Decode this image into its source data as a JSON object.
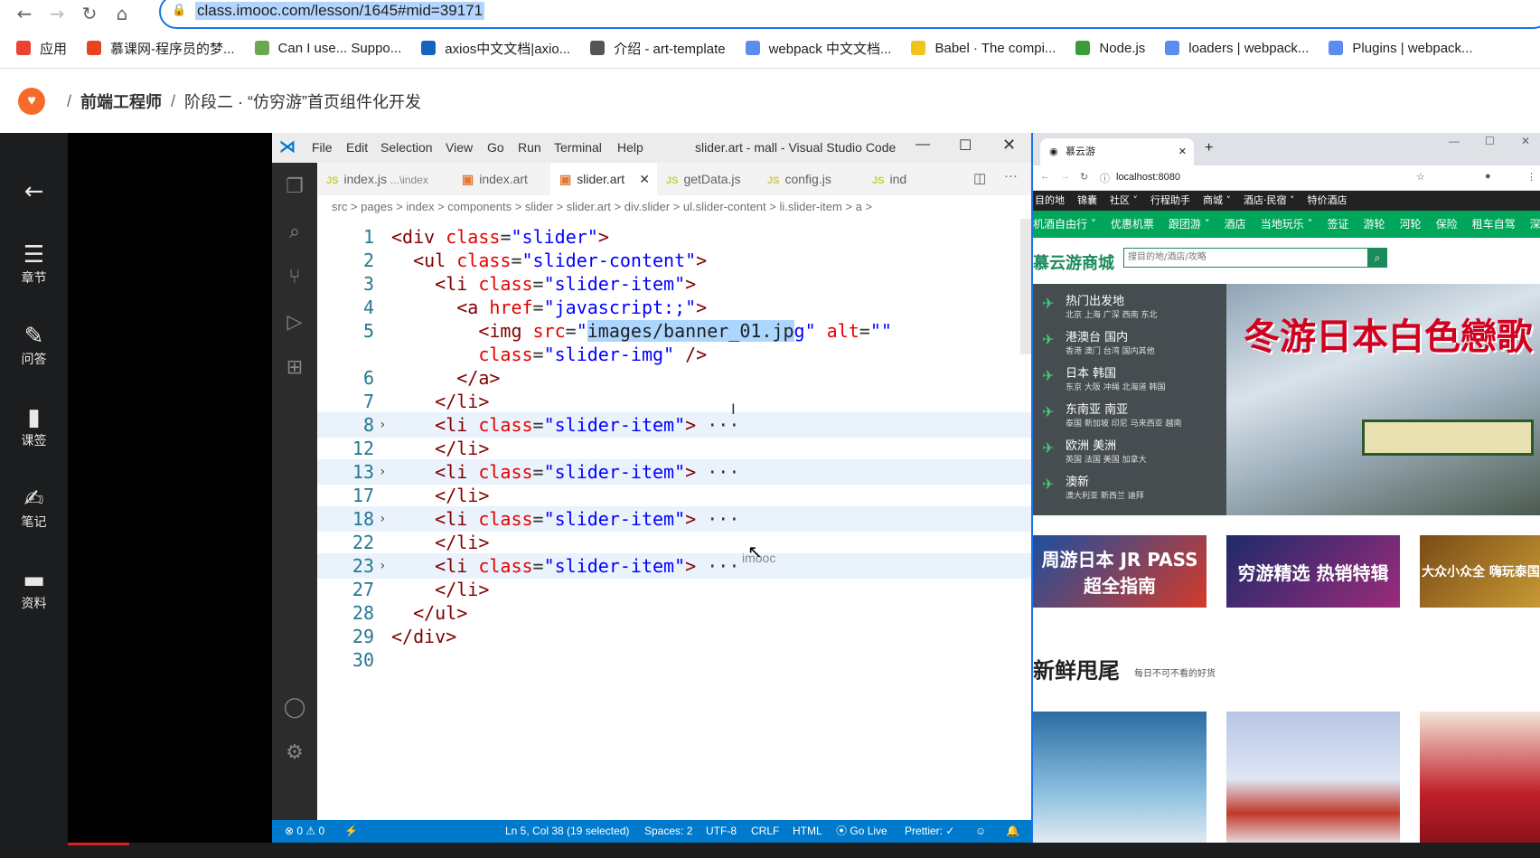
{
  "browser": {
    "url": "class.imooc.com/lesson/1645#mid=39171",
    "bookmarks": [
      "应用",
      "慕课网-程序员的梦...",
      "Can I use... Suppo...",
      "axios中文文档|axio...",
      "介绍 - art-template",
      "webpack 中文文档...",
      "Babel · The compi...",
      "Node.js",
      "loaders | webpack...",
      "Plugins | webpack..."
    ]
  },
  "site": {
    "breadcrumb": [
      "前端工程师",
      "阶段二 · “仿穷游”首页组件化开发"
    ]
  },
  "leftnav": [
    {
      "icon": "back-arrow-icon",
      "label": ""
    },
    {
      "icon": "chapters-icon",
      "label": "章节"
    },
    {
      "icon": "qa-icon",
      "label": "问答"
    },
    {
      "icon": "bookmark-icon",
      "label": "课签"
    },
    {
      "icon": "note-icon",
      "label": "笔记"
    },
    {
      "icon": "folder-icon",
      "label": "资料"
    }
  ],
  "vscode": {
    "menu": [
      "File",
      "Edit",
      "Selection",
      "View",
      "Go",
      "Run",
      "Terminal",
      "Help"
    ],
    "window_title": "slider.art - mall - Visual Studio Code",
    "tabs": [
      {
        "name": "index.js",
        "hint": "...\\index",
        "kind": "js"
      },
      {
        "name": "index.art",
        "hint": "",
        "kind": "html"
      },
      {
        "name": "slider.art",
        "hint": "",
        "kind": "html",
        "active": true
      },
      {
        "name": "getData.js",
        "hint": "",
        "kind": "js"
      },
      {
        "name": "config.js",
        "hint": "",
        "kind": "js"
      },
      {
        "name": "ind",
        "hint": "",
        "kind": "js"
      }
    ],
    "breadcrumb": "src > pages > index > components > slider > slider.art > div.slider > ul.slider-content > li.slider-item > a >",
    "code_lines": [
      {
        "n": "1",
        "parts": [
          [
            "tg",
            "<div "
          ],
          [
            "at",
            "class"
          ],
          [
            "pu",
            "="
          ],
          [
            "st",
            "\"slider\""
          ],
          [
            "tg",
            ">"
          ]
        ]
      },
      {
        "n": "2",
        "parts": [
          [
            "tg",
            "  <ul "
          ],
          [
            "at",
            "class"
          ],
          [
            "pu",
            "="
          ],
          [
            "st",
            "\"slider-content\""
          ],
          [
            "tg",
            ">"
          ]
        ]
      },
      {
        "n": "3",
        "parts": [
          [
            "tg",
            "    <li "
          ],
          [
            "at",
            "class"
          ],
          [
            "pu",
            "="
          ],
          [
            "st",
            "\"slider-item\""
          ],
          [
            "tg",
            ">"
          ]
        ]
      },
      {
        "n": "4",
        "parts": [
          [
            "tg",
            "      <a "
          ],
          [
            "at",
            "href"
          ],
          [
            "pu",
            "="
          ],
          [
            "st",
            "\"javascript:;\""
          ],
          [
            "tg",
            ">"
          ]
        ]
      },
      {
        "n": "5",
        "parts": [
          [
            "tg",
            "        <img "
          ],
          [
            "at",
            "src"
          ],
          [
            "pu",
            "="
          ],
          [
            "st",
            "\""
          ],
          [
            "sel",
            "images/banner_01.jp"
          ],
          [
            "st",
            "g\" "
          ],
          [
            "at",
            "alt"
          ],
          [
            "pu",
            "="
          ],
          [
            "st",
            "\"\""
          ]
        ]
      },
      {
        "n": "",
        "parts": [
          [
            "at",
            "        class"
          ],
          [
            "pu",
            "="
          ],
          [
            "st",
            "\"slider-img\" "
          ],
          [
            "tg",
            "/>"
          ]
        ]
      },
      {
        "n": "6",
        "parts": [
          [
            "tg",
            "      </a>"
          ]
        ]
      },
      {
        "n": "7",
        "parts": [
          [
            "tg",
            "    </li>"
          ]
        ]
      },
      {
        "n": "8",
        "parts": [
          [
            "tg",
            "    <li "
          ],
          [
            "at",
            "class"
          ],
          [
            "pu",
            "="
          ],
          [
            "st",
            "\"slider-item\""
          ],
          [
            "tg",
            "> "
          ],
          [
            "pu",
            "···"
          ]
        ],
        "fold": true
      },
      {
        "n": "12",
        "parts": [
          [
            "tg",
            "    </li>"
          ]
        ]
      },
      {
        "n": "13",
        "parts": [
          [
            "tg",
            "    <li "
          ],
          [
            "at",
            "class"
          ],
          [
            "pu",
            "="
          ],
          [
            "st",
            "\"slider-item\""
          ],
          [
            "tg",
            "> "
          ],
          [
            "pu",
            "···"
          ]
        ],
        "fold": true
      },
      {
        "n": "17",
        "parts": [
          [
            "tg",
            "    </li>"
          ]
        ]
      },
      {
        "n": "18",
        "parts": [
          [
            "tg",
            "    <li "
          ],
          [
            "at",
            "class"
          ],
          [
            "pu",
            "="
          ],
          [
            "st",
            "\"slider-item\""
          ],
          [
            "tg",
            "> "
          ],
          [
            "pu",
            "···"
          ]
        ],
        "fold": true
      },
      {
        "n": "22",
        "parts": [
          [
            "tg",
            "    </li>"
          ]
        ]
      },
      {
        "n": "23",
        "parts": [
          [
            "tg",
            "    <li "
          ],
          [
            "at",
            "class"
          ],
          [
            "pu",
            "="
          ],
          [
            "st",
            "\"slider-item\""
          ],
          [
            "tg",
            "> "
          ],
          [
            "pu",
            "···"
          ]
        ],
        "fold": true
      },
      {
        "n": "27",
        "parts": [
          [
            "tg",
            "    </li>"
          ]
        ]
      },
      {
        "n": "28",
        "parts": [
          [
            "tg",
            "  </ul>"
          ]
        ]
      },
      {
        "n": "29",
        "parts": [
          [
            "tg",
            "</div>"
          ]
        ]
      },
      {
        "n": "30",
        "parts": []
      }
    ],
    "watermark": "imooc",
    "status": {
      "problems": "⊗ 0 ⚠ 0",
      "position": "Ln 5, Col 38 (19 selected)",
      "spaces": "Spaces: 2",
      "encoding": "UTF-8",
      "eol": "CRLF",
      "language": "HTML",
      "golive": "Go Live",
      "prettier": "Prettier: ✓"
    }
  },
  "preview": {
    "tab_title": "慕云游",
    "address": "localhost:8080",
    "topnav": [
      "目的地",
      "锦囊",
      "社区 ˅",
      "行程助手",
      "商城 ˅",
      "酒店·民宿 ˅",
      "特价酒店"
    ],
    "greennav": [
      "机酒自由行 ˅",
      "优惠机票",
      "跟团游 ˅",
      "酒店",
      "当地玩乐 ˅",
      "签证",
      "游轮",
      "河轮",
      "保险",
      "租车自驾",
      "深度旅行"
    ],
    "brand": "慕云游商城",
    "search_placeholder": "搜目的地/酒店/攻略",
    "categories": [
      {
        "title": "热门出发地",
        "sub": "北京 上海 广深 西南 东北"
      },
      {
        "title": "港澳台 国内",
        "sub": "香港 澳门 台湾 国内其他"
      },
      {
        "title": "日本 韩国",
        "sub": "东京 大阪 冲绳 北海道 韩国"
      },
      {
        "title": "东南亚 南亚",
        "sub": "泰国 新加坡 印尼 马来西亚 越南"
      },
      {
        "title": "欧洲 美洲",
        "sub": "英国 法国 美国 加拿大"
      },
      {
        "title": "澳新",
        "sub": "澳大利亚 新西兰 迪拜"
      }
    ],
    "banner_text": "冬游日本白色戀歌",
    "promos": [
      "周游日本 JR PASS 超全指南",
      "穷游精选 热销特辑",
      "大众小众全 嗨玩泰国"
    ],
    "section_title": "新鲜甩尾",
    "section_sub": "每日不可不看的好货",
    "colors": {
      "accent": "#00a65a",
      "vscode_status": "#007acc",
      "brand_red": "#d2001f"
    }
  }
}
